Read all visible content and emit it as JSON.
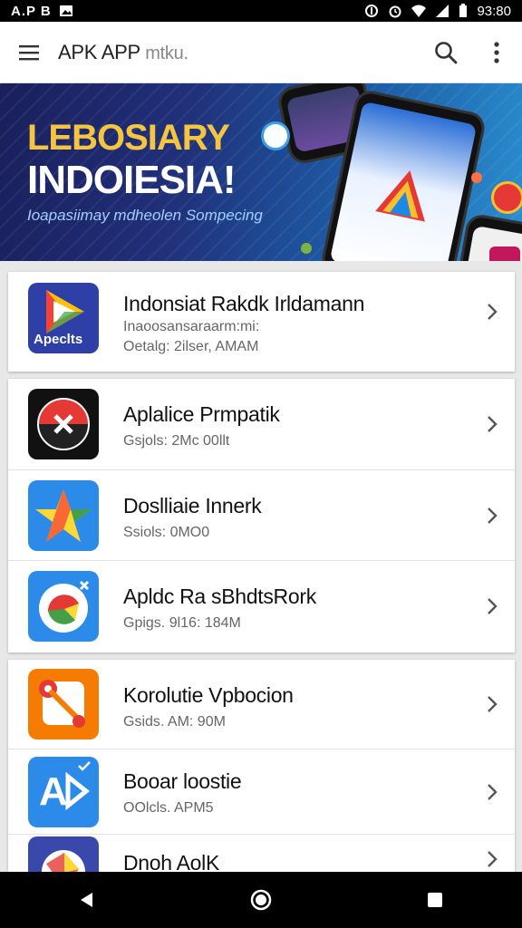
{
  "status_bar": {
    "left_text": "A.P B",
    "time": "93:80",
    "icons": [
      "image-icon",
      "data-saver-icon",
      "alarm-icon",
      "wifi-icon",
      "signal-icon",
      "battery-icon"
    ]
  },
  "app_bar": {
    "title": "APK APP",
    "title_suffix": "mtku.",
    "icons": [
      "menu-icon",
      "search-icon",
      "more-vert-icon"
    ]
  },
  "banner": {
    "line1": "LEBOSIARY",
    "line2": "INDOIESIA!",
    "subtitle": "Ioapasiimay mdheolen Sompecing"
  },
  "apps": [
    {
      "name": "Indonsiat Rakdk Irldamann",
      "line1": "Inaoosansaraarm:mi:",
      "line2": "Oetalg: 2ilser, AMAM",
      "icon": "play-store-icon",
      "icon_text": "Apeclts"
    },
    {
      "name": "Aplalice Prmpatik",
      "line1": "Gsjols: 2Mc 00llt",
      "icon": "red-compass-icon"
    },
    {
      "name": "Doslliaie Innerk",
      "line1": "Ssiols: 0MO0",
      "icon": "star-icon"
    },
    {
      "name": "Apldc Ra sBhdtsRork",
      "line1": "Gpigs. 9l16: 184M",
      "icon": "circle-arrow-icon"
    },
    {
      "name": "Korolutie Vpbocion",
      "line1": "Gsids. AM: 90M",
      "icon": "orange-tools-icon"
    },
    {
      "name": "Booar loostie",
      "line1": "OOlcls. APM5",
      "icon": "ad-icon",
      "icon_text": "A"
    },
    {
      "name": "Dnoh AolK",
      "line1": "",
      "icon": "globe-icon"
    }
  ],
  "nav_bar": {
    "icons": [
      "back-icon",
      "home-icon",
      "recents-icon"
    ]
  },
  "colors": {
    "banner_yellow": "#f5c542",
    "banner_blue": "#20307a",
    "text": "#111111"
  }
}
